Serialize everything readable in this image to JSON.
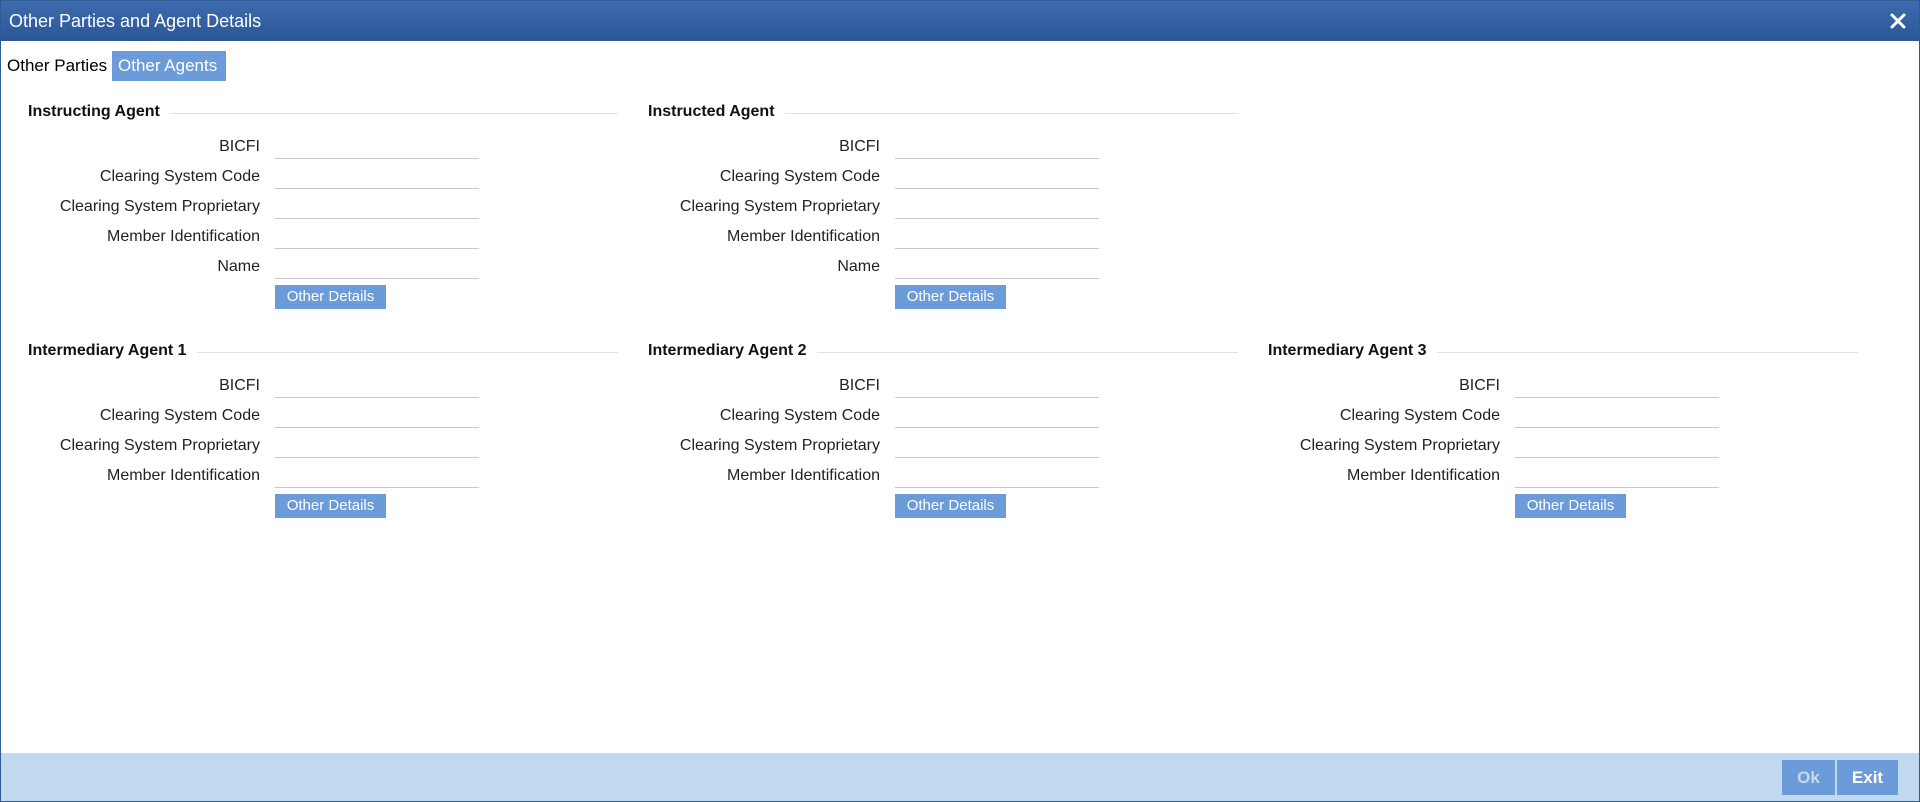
{
  "window": {
    "title": "Other Parties and Agent Details",
    "close_icon": "close-icon"
  },
  "tabs": [
    {
      "label": "Other Parties",
      "active": false
    },
    {
      "label": "Other Agents",
      "active": true
    }
  ],
  "sections": {
    "instructing_agent": {
      "title": "Instructing Agent",
      "fields": {
        "bicfi": {
          "label": "BICFI",
          "value": ""
        },
        "clearing_system_code": {
          "label": "Clearing System Code",
          "value": ""
        },
        "clearing_system_proprietary": {
          "label": "Clearing System Proprietary",
          "value": ""
        },
        "member_identification": {
          "label": "Member Identification",
          "value": ""
        },
        "name": {
          "label": "Name",
          "value": ""
        }
      },
      "button": "Other Details"
    },
    "instructed_agent": {
      "title": "Instructed Agent",
      "fields": {
        "bicfi": {
          "label": "BICFI",
          "value": ""
        },
        "clearing_system_code": {
          "label": "Clearing System Code",
          "value": ""
        },
        "clearing_system_proprietary": {
          "label": "Clearing System Proprietary",
          "value": ""
        },
        "member_identification": {
          "label": "Member Identification",
          "value": ""
        },
        "name": {
          "label": "Name",
          "value": ""
        }
      },
      "button": "Other Details"
    },
    "intermediary_agent_1": {
      "title": "Intermediary Agent 1",
      "fields": {
        "bicfi": {
          "label": "BICFI",
          "value": ""
        },
        "clearing_system_code": {
          "label": "Clearing System Code",
          "value": ""
        },
        "clearing_system_proprietary": {
          "label": "Clearing System Proprietary",
          "value": ""
        },
        "member_identification": {
          "label": "Member Identification",
          "value": ""
        }
      },
      "button": "Other Details"
    },
    "intermediary_agent_2": {
      "title": "Intermediary Agent 2",
      "fields": {
        "bicfi": {
          "label": "BICFI",
          "value": ""
        },
        "clearing_system_code": {
          "label": "Clearing System Code",
          "value": ""
        },
        "clearing_system_proprietary": {
          "label": "Clearing System Proprietary",
          "value": ""
        },
        "member_identification": {
          "label": "Member Identification",
          "value": ""
        }
      },
      "button": "Other Details"
    },
    "intermediary_agent_3": {
      "title": "Intermediary Agent 3",
      "fields": {
        "bicfi": {
          "label": "BICFI",
          "value": ""
        },
        "clearing_system_code": {
          "label": "Clearing System Code",
          "value": ""
        },
        "clearing_system_proprietary": {
          "label": "Clearing System Proprietary",
          "value": ""
        },
        "member_identification": {
          "label": "Member Identification",
          "value": ""
        }
      },
      "button": "Other Details"
    }
  },
  "footer": {
    "ok_label": "Ok",
    "ok_enabled": false,
    "exit_label": "Exit"
  },
  "colors": {
    "title_bar": "#2b5797",
    "accent": "#6b9bd8",
    "footer_bg": "#c1d9ee"
  }
}
